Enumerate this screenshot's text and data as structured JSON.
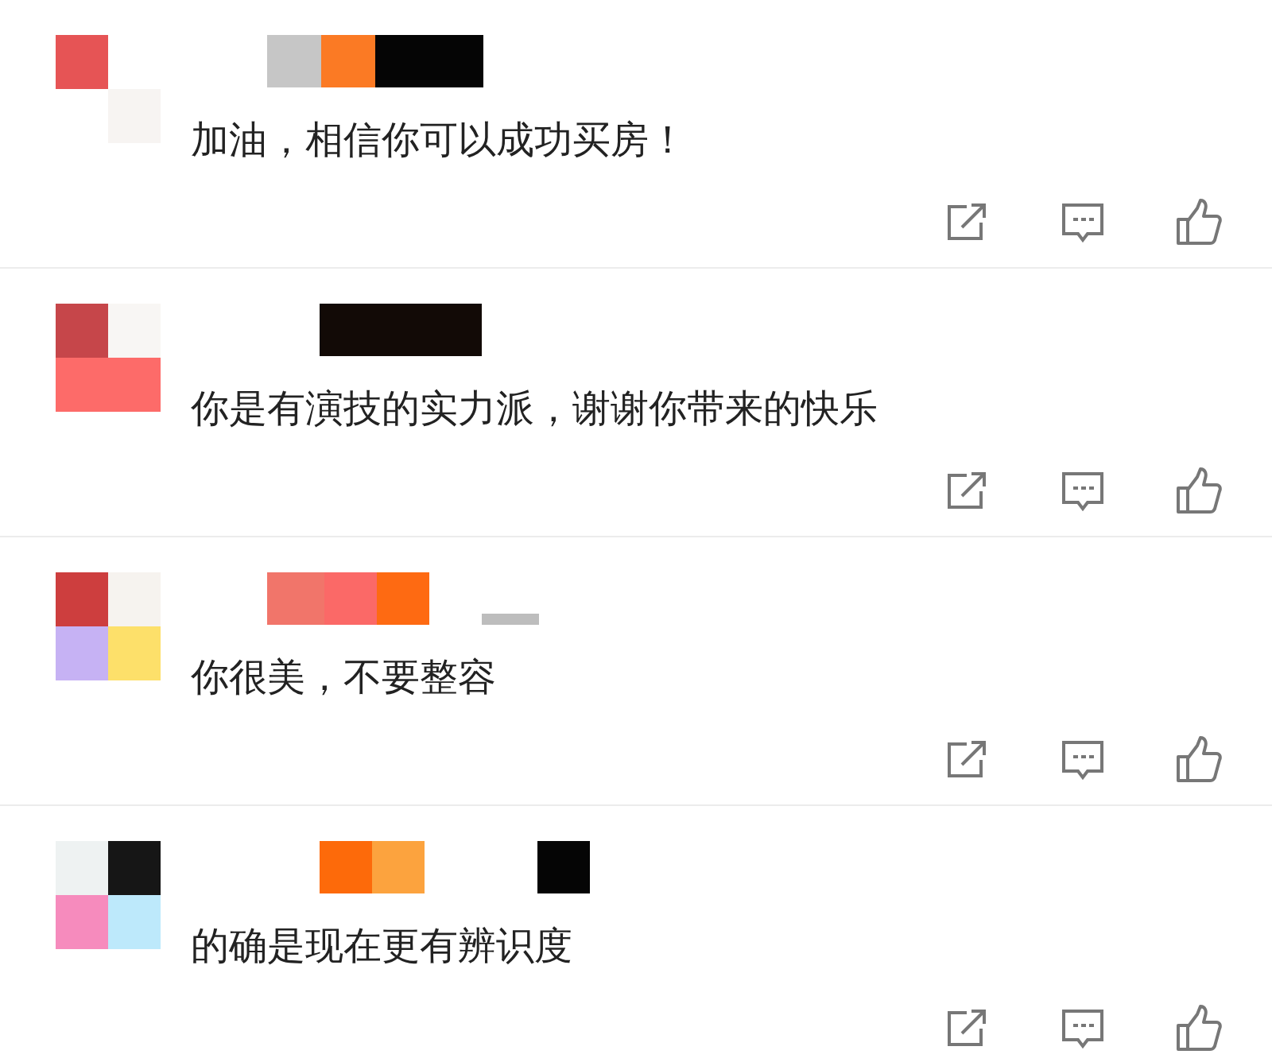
{
  "comments": [
    {
      "text": "加油，相信你可以成功买房！"
    },
    {
      "text": "你是有演技的实力派，谢谢你带来的快乐"
    },
    {
      "text": "你很美，不要整容"
    },
    {
      "text": "的确是现在更有辨识度"
    }
  ]
}
